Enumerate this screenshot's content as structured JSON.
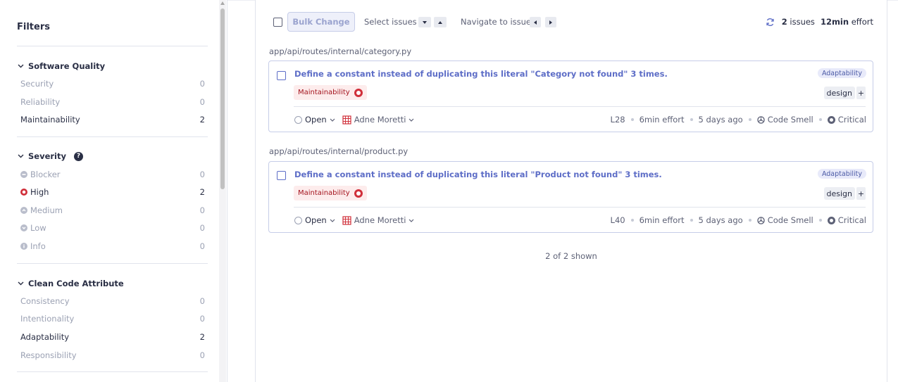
{
  "sidebar": {
    "title": "Filters",
    "software_quality": {
      "header": "Software Quality",
      "items": [
        {
          "label": "Security",
          "count": "0"
        },
        {
          "label": "Reliability",
          "count": "0"
        },
        {
          "label": "Maintainability",
          "count": "2"
        }
      ]
    },
    "severity": {
      "header": "Severity",
      "help": "?",
      "items": [
        {
          "label": "Blocker",
          "count": "0",
          "icon": "blocker-icon"
        },
        {
          "label": "High",
          "count": "2",
          "icon": "high-icon"
        },
        {
          "label": "Medium",
          "count": "0",
          "icon": "medium-icon"
        },
        {
          "label": "Low",
          "count": "0",
          "icon": "low-icon"
        },
        {
          "label": "Info",
          "count": "0",
          "icon": "info-icon"
        }
      ]
    },
    "clean_code": {
      "header": "Clean Code Attribute",
      "items": [
        {
          "label": "Consistency",
          "count": "0"
        },
        {
          "label": "Intentionality",
          "count": "0"
        },
        {
          "label": "Adaptability",
          "count": "2"
        },
        {
          "label": "Responsibility",
          "count": "0"
        }
      ]
    }
  },
  "toolbar": {
    "bulk_change": "Bulk Change",
    "select_issues": "Select issues",
    "navigate": "Navigate to issue",
    "issues_count": "2",
    "issues_label": "issues",
    "effort_value": "12min",
    "effort_label": "effort"
  },
  "issues": [
    {
      "path": "app/api/routes/internal/category.py",
      "title": "Define a constant instead of duplicating this literal \"Category not found\" 3 times.",
      "quality": "Maintainability",
      "attribute": "Adaptability",
      "tag": "design",
      "tag_add": "+",
      "status": "Open",
      "assignee": "Adne Moretti",
      "line": "L28",
      "effort": "6min effort",
      "age": "5 days ago",
      "type": "Code Smell",
      "severity": "Critical"
    },
    {
      "path": "app/api/routes/internal/product.py",
      "title": "Define a constant instead of duplicating this literal \"Product not found\" 3 times.",
      "quality": "Maintainability",
      "attribute": "Adaptability",
      "tag": "design",
      "tag_add": "+",
      "status": "Open",
      "assignee": "Adne Moretti",
      "line": "L40",
      "effort": "6min effort",
      "age": "5 days ago",
      "type": "Code Smell",
      "severity": "Critical"
    }
  ],
  "shown_text": "2 of 2 shown",
  "colors": {
    "accent": "#5e6ec7",
    "high": "#d02f3a",
    "border": "#c6cde8"
  }
}
